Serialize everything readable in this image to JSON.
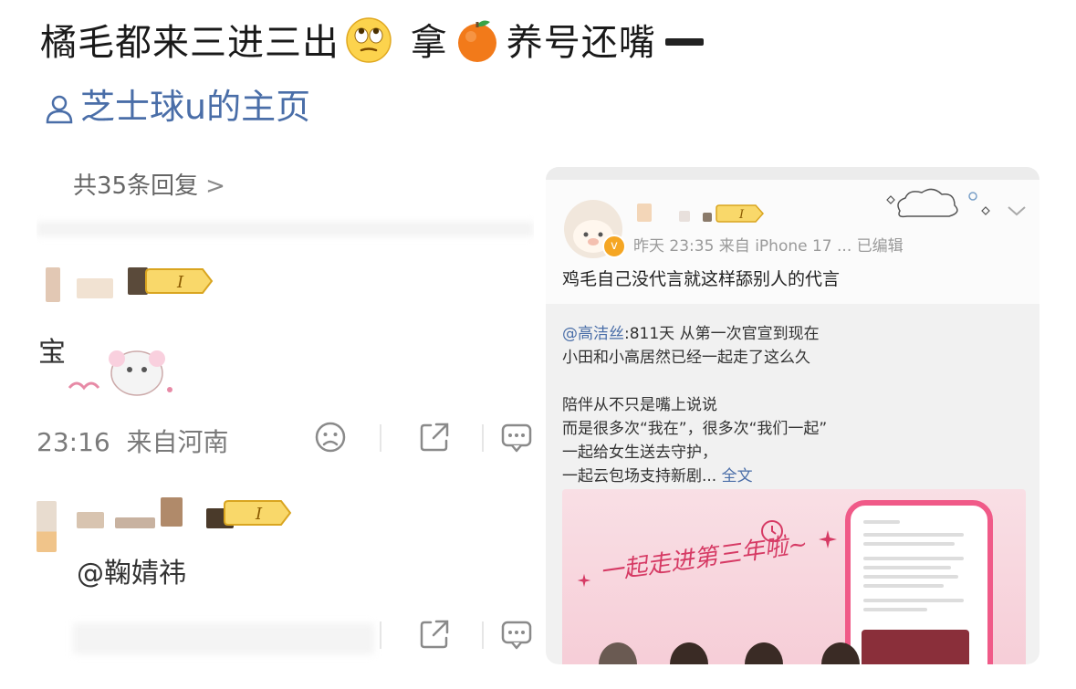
{
  "post": {
    "title_part1": "橘毛都来三进三出",
    "title_part2": "拿",
    "title_part3": "养号还嘴",
    "author": "芝士球u的主页"
  },
  "left_screenshot": {
    "reply_count": "共35条回复",
    "comment1": {
      "text": "宝",
      "time": "23:16",
      "location": "来自河南"
    },
    "comment2": {
      "text": "@鞠婧祎"
    },
    "badge_label": "I"
  },
  "right_screenshot": {
    "meta": "昨天 23:35  来自 iPhone 17 ...  已编辑",
    "body": "鸡毛自己没代言就这样舔别人的代言",
    "badge_label": "I",
    "repost": {
      "mention": "@高洁丝",
      "line1_rest": ":811天 从第一次官宣到现在",
      "line2": "小田和小高居然已经一起走了这么久",
      "line3": "陪伴从不只是嘴上说说",
      "line4": "而是很多次“我在”，很多次“我们一起”",
      "line5": "一起给女生送去守护，",
      "line6": "一起云包场支持新剧...",
      "more": "全文"
    },
    "promo_text": "一起走进第三年啦~"
  },
  "colors": {
    "link_blue": "#4a6ea8",
    "orange": "#f5a623",
    "pink": "#f05a88"
  }
}
